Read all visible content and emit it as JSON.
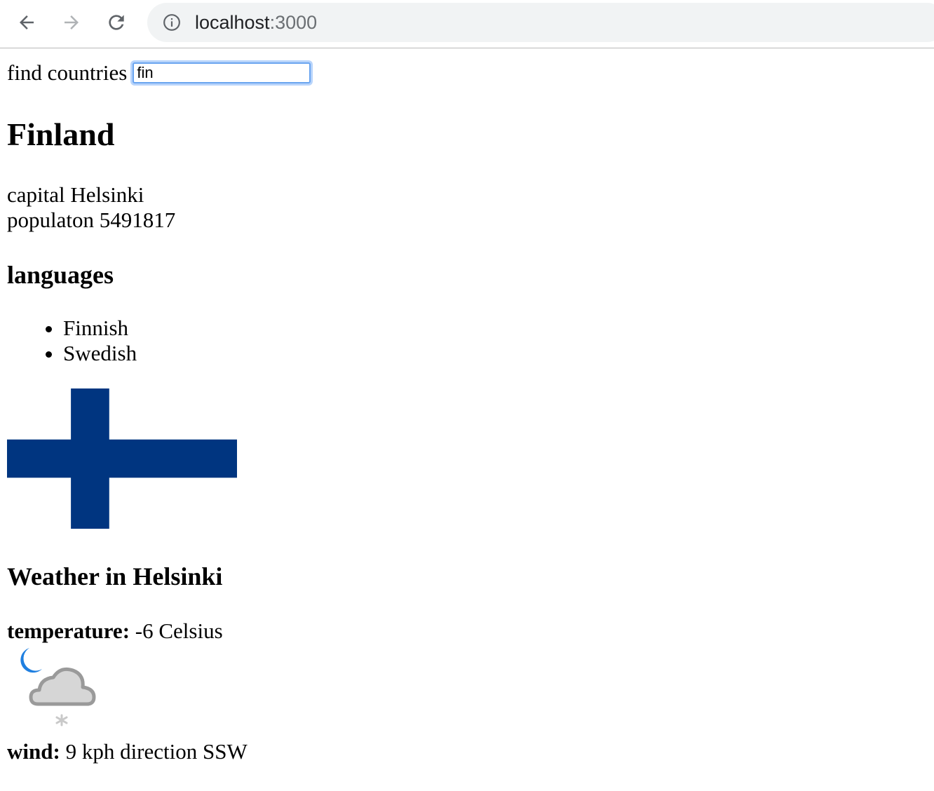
{
  "browser": {
    "url_host": "localhost",
    "url_port": ":3000"
  },
  "search": {
    "label": "find countries",
    "value": "fin"
  },
  "country": {
    "name": "Finland",
    "capital_label": "capital",
    "capital": "Helsinki",
    "population_label": "populaton",
    "population": "5491817",
    "languages_heading": "languages",
    "languages": [
      "Finnish",
      "Swedish"
    ],
    "flag_colors": {
      "background": "#ffffff",
      "cross": "#003580"
    }
  },
  "weather": {
    "heading": "Weather in Helsinki",
    "temperature_label": "temperature:",
    "temperature_value": "-6 Celsius",
    "icon": "night-cloud-snow-icon",
    "wind_label": "wind:",
    "wind_value": "9 kph direction SSW"
  }
}
